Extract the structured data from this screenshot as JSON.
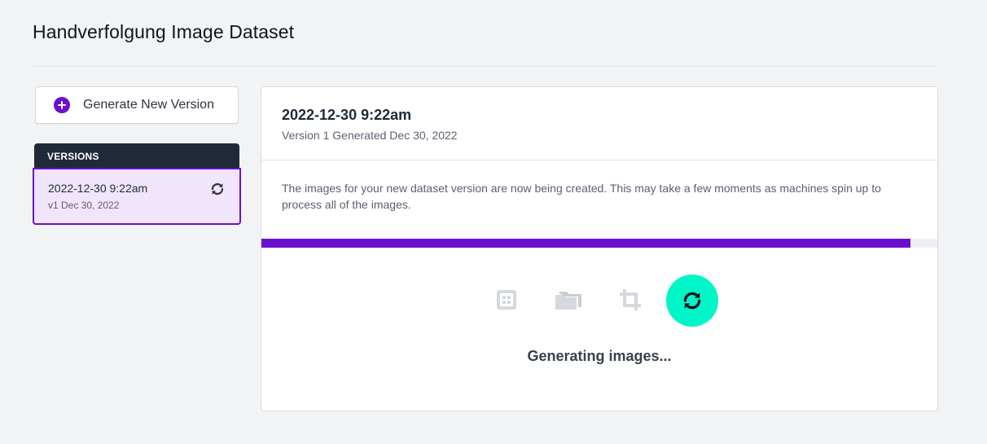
{
  "page": {
    "title": "Handverfolgung Image Dataset"
  },
  "sidebar": {
    "generate_button_label": "Generate New Version",
    "versions_header": "VERSIONS",
    "versions": [
      {
        "title": "2022-12-30 9:22am",
        "subtitle": "v1 Dec 30, 2022",
        "status_icon": "sync-icon"
      }
    ]
  },
  "detail": {
    "title": "2022-12-30 9:22am",
    "subtitle": "Version 1 Generated Dec 30, 2022",
    "description": "The images for your new dataset version are now being created. This may take a few moments as machines spin up to process all of the images.",
    "progress_fraction": 0.96,
    "steps": [
      {
        "icon": "preprocessing-icon",
        "state": "done"
      },
      {
        "icon": "folder-icon",
        "state": "done"
      },
      {
        "icon": "crop-icon",
        "state": "done"
      },
      {
        "icon": "sync-icon",
        "state": "active"
      }
    ],
    "status_text": "Generating images..."
  },
  "colors": {
    "accent": "#6b0fcf",
    "accent_light": "#f1e5fd",
    "active_step": "#00f5c8",
    "header_dark": "#1f2937",
    "inactive_icon": "#d5d8dd"
  }
}
